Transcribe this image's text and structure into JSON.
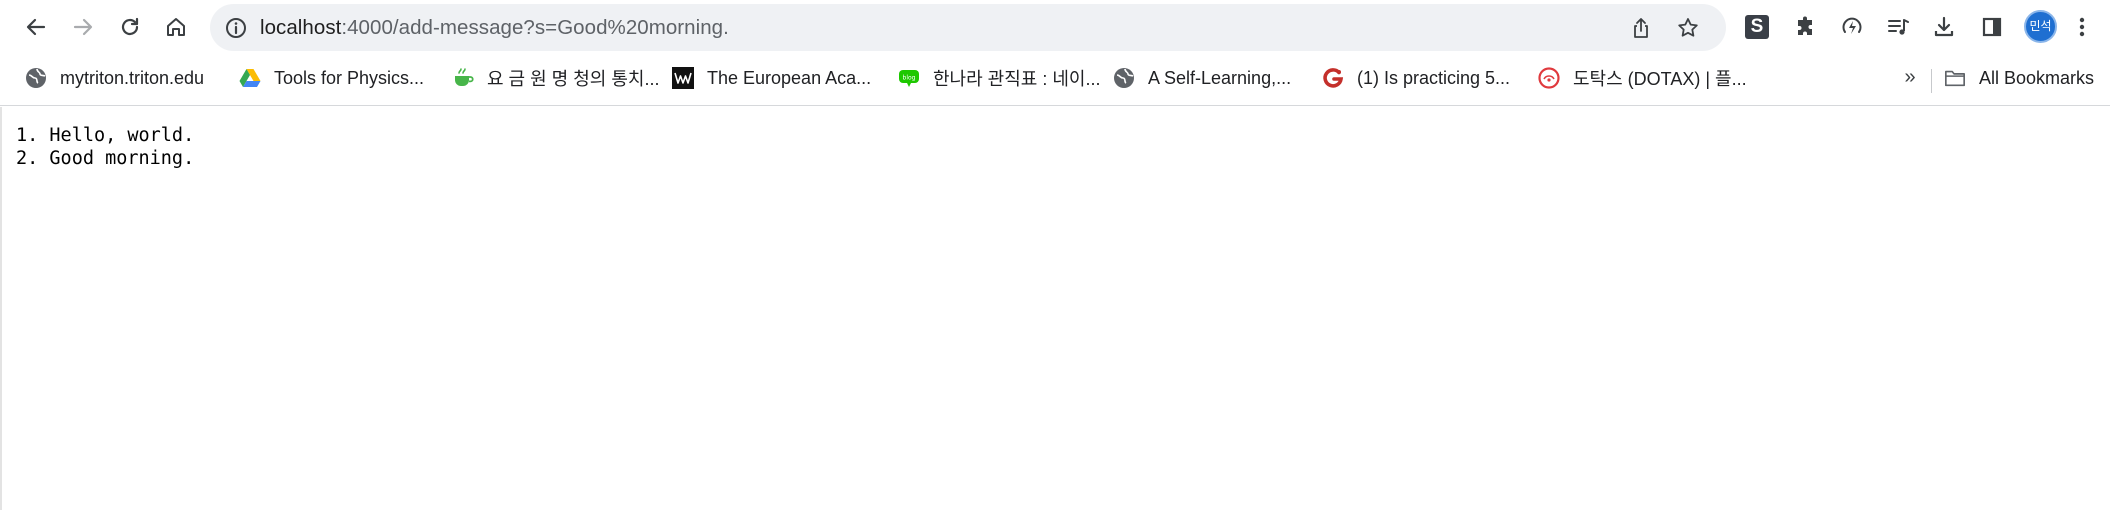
{
  "browser": {
    "url_host": "localhost",
    "url_path": ":4000/add-message?s=Good%20morning.",
    "extension_s_label": "S",
    "profile_initials": "민석",
    "colors": {
      "omnibox_bg": "#eff1f4",
      "avatar_bg": "#1f6fd1",
      "toolbar_icon": "#3c4043"
    },
    "toolbar_icons": [
      "back-icon",
      "forward-icon",
      "reload-icon",
      "home-icon",
      "info-icon",
      "share-icon",
      "star-icon",
      "puzzle-icon",
      "performance-icon",
      "reading-list-icon",
      "download-icon",
      "side-panel-icon",
      "more-icon"
    ]
  },
  "bookmarks": {
    "items": [
      {
        "label": "mytriton.triton.edu",
        "icon": "globe-icon"
      },
      {
        "label": "Tools for Physics...",
        "icon": "google-drive-icon"
      },
      {
        "label": "요 금 원 명 청의 통치...",
        "icon": "cup-icon"
      },
      {
        "label": "The European Aca...",
        "icon": "w-logo-icon"
      },
      {
        "label": "한나라 관직표 : 네이...",
        "icon": "naver-blog-icon"
      },
      {
        "label": "A Self-Learning,...",
        "icon": "globe-icon"
      },
      {
        "label": "(1) Is practicing 5...",
        "icon": "red-g-icon"
      },
      {
        "label": "도탁스 (DOTAX) | 플...",
        "icon": "dotax-icon"
      }
    ],
    "overflow_label": "»",
    "all_bookmarks_label": "All Bookmarks"
  },
  "page": {
    "messages": [
      "1. Hello, world.",
      "2. Good morning."
    ]
  }
}
